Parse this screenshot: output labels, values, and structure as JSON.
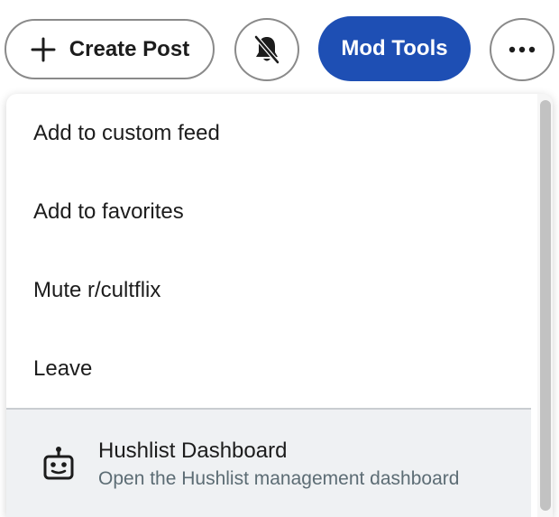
{
  "header": {
    "create_post_label": "Create Post",
    "mod_tools_label": "Mod Tools",
    "mod_tools_color": "#1e4fb4",
    "plus_icon": "plus-icon",
    "bell_icon": "bell-off-icon",
    "more_icon": "ellipsis-icon"
  },
  "menu": {
    "items": [
      {
        "label": "Add to custom feed"
      },
      {
        "label": "Add to favorites"
      },
      {
        "label": "Mute r/cultflix"
      },
      {
        "label": "Leave"
      }
    ],
    "app": {
      "title": "Hushlist Dashboard",
      "subtitle": "Open the Hushlist management dashboard",
      "icon": "robot-icon"
    }
  }
}
